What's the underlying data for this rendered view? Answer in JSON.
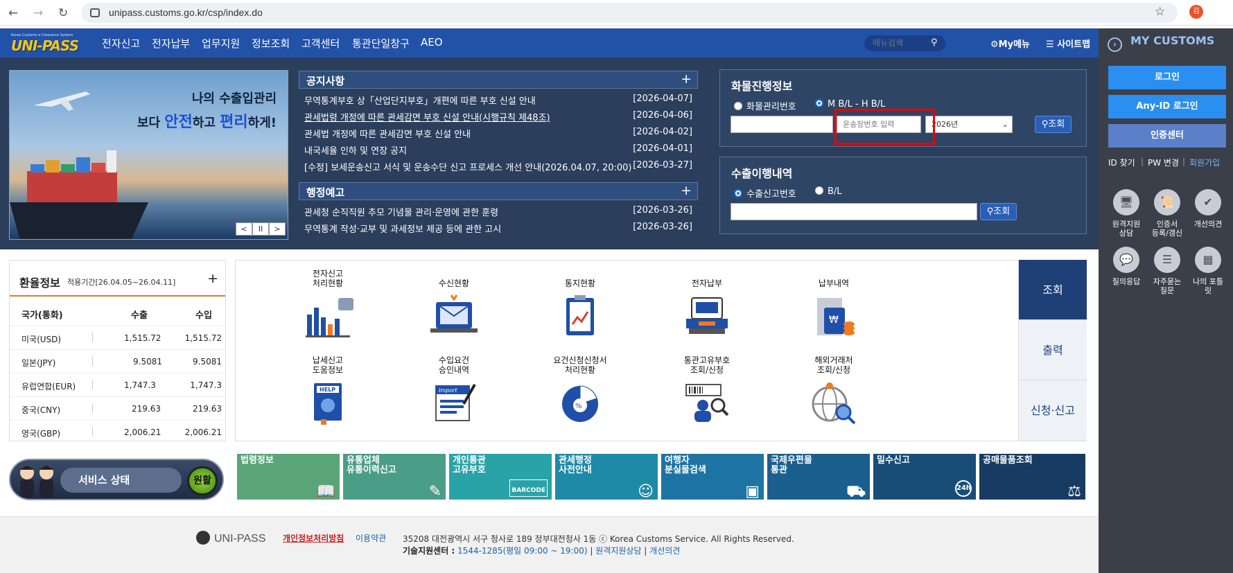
{
  "browser": {
    "url": "unipass.customs.go.kr/csp/index.do",
    "profile_initial": "김"
  },
  "header": {
    "logo_sub": "Korea Customs e-Clearance System",
    "logo": "UNI-PASS",
    "menu": [
      "전자신고",
      "전자납부",
      "업무지원",
      "정보조회",
      "고객센터",
      "통관단일창구",
      "AEO"
    ],
    "search_placeholder": "메뉴검색",
    "mymenu": "My메뉴",
    "sitemap": "사이트맵"
  },
  "banner": {
    "title": "나의 수출입관리",
    "sub_pre": "보다 ",
    "sub_b1": "안전",
    "sub_mid": "하고 ",
    "sub_b2": "편리",
    "sub_post": "하게!",
    "controls": [
      "<",
      "II",
      ">"
    ]
  },
  "notices": {
    "title": "공지사항",
    "items": [
      {
        "text": "무역통계부호 상「산업단지부호」개편에 따른 부호 신설 안내",
        "date": "[2026-04-07]"
      },
      {
        "text": "관세법령 개정에 따른 관세감면 부호 신설 안내(시행규칙 제48조)",
        "date": "[2026-04-06]"
      },
      {
        "text": "관세법 개정에 따른 관세감면 부호 신설 안내",
        "date": "[2026-04-02]"
      },
      {
        "text": "내국세율 인하 및 연장 공지",
        "date": "[2026-04-01]"
      },
      {
        "text": "[수정] 보세운송신고 서식 및 운송수단 신고 프로세스 개선 안내(2026.04.07, 20:00)",
        "date": "[2026-03-27]"
      }
    ]
  },
  "admin_notice": {
    "title": "행정예고",
    "items": [
      {
        "text": "관세청 순직직원 추모 기념물 관리·운영에 관한 훈령",
        "date": "[2026-03-26]"
      },
      {
        "text": "무역통계 작성·교부 및 과세정보 제공 등에 관한 고시",
        "date": "[2026-03-26]"
      }
    ]
  },
  "cargo": {
    "title": "화물진행정보",
    "radio1": "화물관리번호",
    "radio2": "M B/L - H B/L",
    "placeholder": "운송장번호 입력",
    "year": "2026년",
    "btn": "조회"
  },
  "export": {
    "title": "수출이행내역",
    "radio1": "수출신고번호",
    "radio2": "B/L",
    "btn": "조회"
  },
  "exchange": {
    "title": "환율정보",
    "period": "적용기간[26.04.05~26.04.11]",
    "headers": [
      "국가(통화)",
      "수출",
      "수입"
    ],
    "rows": [
      {
        "country": "미국(USD)",
        "exp": "1,515.72",
        "imp": "1,515.72"
      },
      {
        "country": "일본(JPY)",
        "exp": "9.5081",
        "imp": "9.5081"
      },
      {
        "country": "유럽연합(EUR)",
        "exp": "1,747.3",
        "imp": "1,747.3"
      },
      {
        "country": "중국(CNY)",
        "exp": "219.63",
        "imp": "219.63"
      },
      {
        "country": "영국(GBP)",
        "exp": "2,006.21",
        "imp": "2,006.21"
      }
    ]
  },
  "service": {
    "label": "서비스 상태",
    "state": "원활"
  },
  "grid": {
    "row1": [
      {
        "l1": "전자신고",
        "l2": "처리현황"
      },
      {
        "l1": "",
        "l2": "수신현황"
      },
      {
        "l1": "",
        "l2": "통지현황"
      },
      {
        "l1": "",
        "l2": "전자납부"
      },
      {
        "l1": "",
        "l2": "납부내역"
      }
    ],
    "row2": [
      {
        "l1": "납세신고",
        "l2": "도움정보"
      },
      {
        "l1": "수입요건",
        "l2": "승인내역"
      },
      {
        "l1": "요건신청신청서",
        "l2": "처리현황"
      },
      {
        "l1": "통관고유부호",
        "l2": "조회/신청"
      },
      {
        "l1": "해외거래처",
        "l2": "조회/신청"
      }
    ],
    "tabs": [
      "조회",
      "출력",
      "신청·신고"
    ]
  },
  "links": [
    {
      "l1": "법령정보",
      "l2": "",
      "color": "#5aa577"
    },
    {
      "l1": "유통업체",
      "l2": "유통이력신고",
      "color": "#4a9d87"
    },
    {
      "l1": "개인통관",
      "l2": "고유부호",
      "color": "#2aa3a8"
    },
    {
      "l1": "관세행정",
      "l2": "사전안내",
      "color": "#1f8aa8"
    },
    {
      "l1": "여행자",
      "l2": "분실물검색",
      "color": "#1d74a2"
    },
    {
      "l1": "국제우편물",
      "l2": "통관",
      "color": "#1a5f8e"
    },
    {
      "l1": "밀수신고",
      "l2": "",
      "color": "#184d78"
    },
    {
      "l1": "공매물품조회",
      "l2": "",
      "color": "#173b62"
    }
  ],
  "links_icon_barcode": "BARCODE",
  "links_icon_24h": "24h",
  "footer": {
    "logo": "UNI-PASS",
    "privacy": "개인정보처리방침",
    "terms": "이용약관",
    "address": "35208 대전광역시 서구 청사로 189 정부대전청사 1동 ⓒ Korea Customs Service. All Rights Reserved.",
    "support_label": "기술지원센터 :",
    "support_phone": "1544-1285(평일 09:00 ~ 19:00)",
    "remote": "원격지원상담",
    "feedback": "개선의견"
  },
  "right": {
    "title": "MY CUSTOMS",
    "login": "로그인",
    "anyid": "Any-ID 로그인",
    "cert": "인증센터",
    "find_id": "ID 찾기",
    "pw": "PW 변경",
    "join": "회원가입",
    "icons": [
      {
        "l1": "원격지원",
        "l2": "상담"
      },
      {
        "l1": "인증서",
        "l2": "등록/갱신"
      },
      {
        "l1": "개선의견",
        "l2": ""
      },
      {
        "l1": "질의응답",
        "l2": ""
      },
      {
        "l1": "자주묻는",
        "l2": "질문"
      },
      {
        "l1": "나의 포틀",
        "l2": "릿"
      }
    ]
  },
  "colors": {
    "header": "#2251a8",
    "hero": "#2b3e5c",
    "accent_blue": "#2a8ff0",
    "highlight": "#e00000"
  }
}
